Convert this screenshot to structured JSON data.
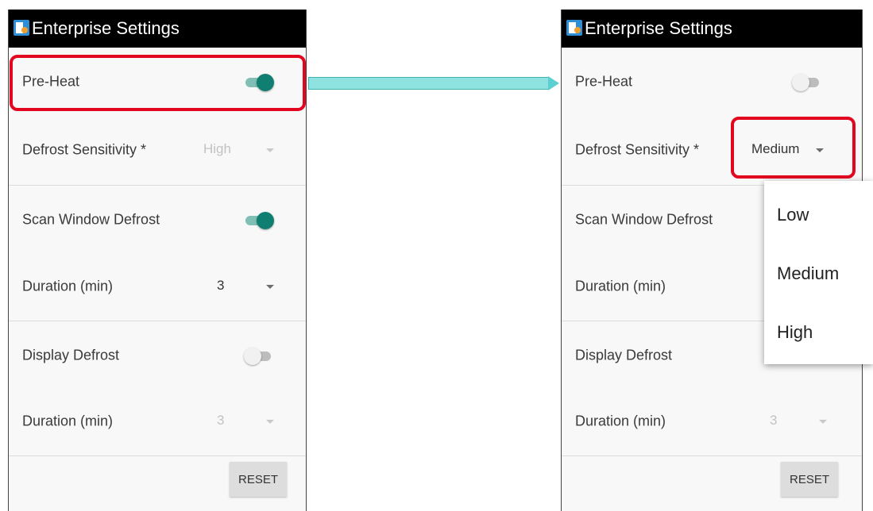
{
  "left_screen": {
    "title": "Enterprise Settings",
    "preheat": {
      "label": "Pre-Heat",
      "on": true
    },
    "defrost_sensitivity": {
      "label": "Defrost Sensitivity *",
      "value": "High",
      "enabled": false
    },
    "scan_window_defrost": {
      "label": "Scan Window Defrost",
      "on": true
    },
    "scan_duration": {
      "label": "Duration (min)",
      "value": "3",
      "enabled": true
    },
    "display_defrost": {
      "label": "Display Defrost",
      "on": false
    },
    "display_duration": {
      "label": "Duration (min)",
      "value": "3",
      "enabled": false
    },
    "reset_label": "RESET"
  },
  "right_screen": {
    "title": "Enterprise Settings",
    "preheat": {
      "label": "Pre-Heat",
      "on": false
    },
    "defrost_sensitivity": {
      "label": "Defrost Sensitivity *",
      "value": "Medium",
      "enabled": true
    },
    "scan_window_defrost": {
      "label": "Scan Window Defrost"
    },
    "scan_duration": {
      "label": "Duration (min)"
    },
    "display_defrost": {
      "label": "Display Defrost"
    },
    "display_duration": {
      "label": "Duration (min)",
      "value": "3",
      "enabled": false
    },
    "reset_label": "RESET"
  },
  "dropdown": {
    "options": [
      "Low",
      "Medium",
      "High"
    ]
  },
  "colors": {
    "highlight": "#e2061f",
    "switch_on": "#107f72",
    "arrow": "#8ee2e0"
  }
}
